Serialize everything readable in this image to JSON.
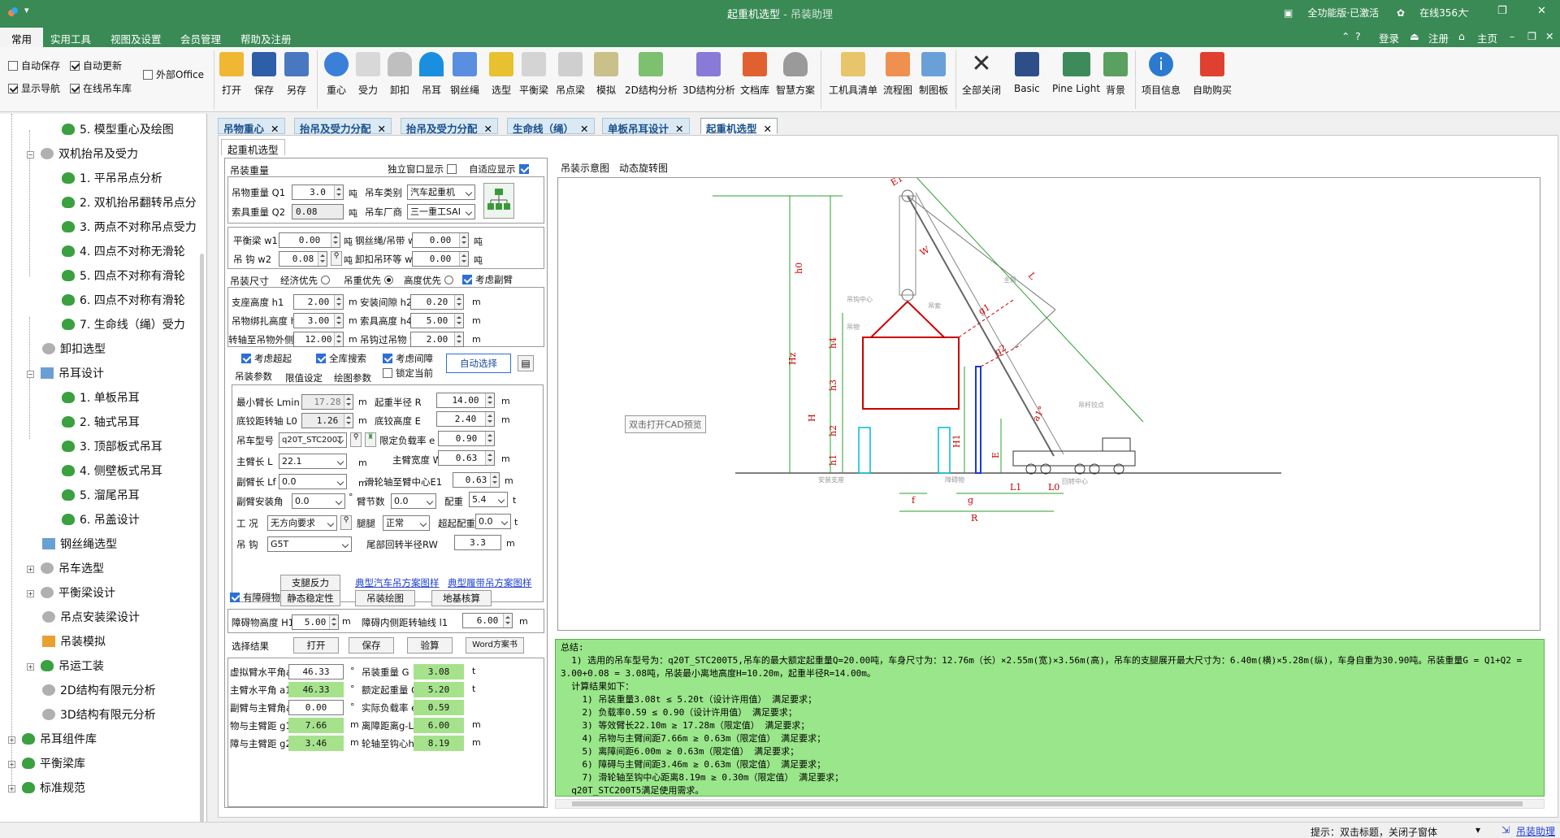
{
  "titlebar": {
    "title": "起重机选型",
    "subtitle": " - 吊装助理",
    "status_license": "全功能版·已激活",
    "status_online": "在线356人"
  },
  "menu": {
    "items": [
      "常用",
      "实用工具",
      "视图及设置",
      "会员管理",
      "帮助及注册"
    ],
    "right": [
      "登录",
      "注册",
      "主页"
    ]
  },
  "ribbon": {
    "checks": [
      {
        "label": "自动保存",
        "on": false
      },
      {
        "label": "自动更新",
        "on": true
      },
      {
        "label": "外部Office",
        "on": false
      },
      {
        "label": "显示导航",
        "on": true
      },
      {
        "label": "在线吊车库",
        "on": true
      }
    ],
    "buttons": [
      "打开",
      "保存",
      "另存",
      "重心",
      "受力",
      "卸扣",
      "吊耳",
      "钢丝绳",
      "选型",
      "平衡梁",
      "吊点梁",
      "模拟",
      "2D结构分析",
      "3D结构分析",
      "文档库",
      "智慧方案",
      "工机具清单",
      "流程图",
      "制图板",
      "全部关闭",
      "Basic",
      "Pine Light",
      "背景",
      "项目信息",
      "自助购买"
    ],
    "colors": {
      "accent": "#3a8a55",
      "summary_bg": "#9ae68a",
      "result_green": "#a6e28c"
    }
  },
  "tree": {
    "items": [
      "5. 模型重心及绘图",
      "双机抬吊及受力",
      "1. 平吊吊点分析",
      "2. 双机抬吊翻转吊点分",
      "3. 两点不对称吊点受力",
      "4. 四点不对称无滑轮",
      "5. 四点不对称有滑轮",
      "6. 四点不对称有滑轮",
      "7. 生命线（绳）受力",
      "卸扣选型",
      "吊耳设计",
      "1. 单板吊耳",
      "2. 轴式吊耳",
      "3. 顶部板式吊耳",
      "4. 侧壁板式吊耳",
      "5. 溜尾吊耳",
      "6. 吊盖设计",
      "钢丝绳选型",
      "吊车选型",
      "平衡梁设计",
      "吊点安装梁设计",
      "吊装模拟",
      "吊运工装",
      "2D结构有限元分析",
      "3D结构有限元分析",
      "吊耳组件库",
      "平衡梁库",
      "标准规范"
    ]
  },
  "doctabs": [
    "吊物重心",
    "抬吊及受力分配",
    "抬吊及受力分配",
    "生命线（绳）",
    "单板吊耳设计",
    "起重机选型"
  ],
  "inner_tab": "起重机选型",
  "form": {
    "sec1": {
      "title": "吊装重量",
      "opt1": "独立窗口显示",
      "opt2": "自适应显示",
      "q1_label": "吊物重量 Q1",
      "q1": "3.0",
      "q1_unit": "吨",
      "q2_label": "索具重量 Q2",
      "q2": "0.08",
      "q2_unit": "吨",
      "type_label": "吊车类别",
      "type": "汽车起重机",
      "maker_label": "吊车厂商",
      "maker": "三一重工SAI",
      "w1_label": "平衡梁 w1",
      "w1": "0.00",
      "w2_label": "吊 钩 w2",
      "w2": "0.08",
      "w3_label": "钢丝绳/吊带 w3",
      "w3": "0.00",
      "w4_label": "卸扣吊环等 w4",
      "w4": "0.00",
      "ton": "吨"
    },
    "sec2": {
      "title": "吊装尺寸",
      "r1": "经济优先",
      "r2": "吊重优先",
      "r3": "高度优先",
      "chk": "考虑副臂",
      "h1_label": "支座高度 h1",
      "h1": "2.00",
      "h3_label": "吊物绑扎高度 h3",
      "h3": "3.00",
      "g_label": "转轴至吊物外侧 g",
      "g": "12.00",
      "h2_label": "安装间隙 h2",
      "h2": "0.20",
      "h4_label": "索具高度 h4",
      "h4": "5.00",
      "f_label": "吊钩过吊物 f",
      "f": "2.00",
      "m": "m"
    },
    "sec3": {
      "c1": "考虑超起",
      "c2": "全库搜索",
      "c3": "考虑间障",
      "c4": "锁定当前",
      "auto_btn": "自动选择",
      "tabs": [
        "吊装参数",
        "限值设定",
        "绘图参数"
      ],
      "lmin_label": "最小臂长 Lmin",
      "lmin": "17.28",
      "l0_label": "底铰距转轴 L0",
      "l0": "1.26",
      "r_label": "起重半径 R",
      "r": "14.00",
      "e_label": "底铰高度 E",
      "e": "2.40",
      "model_label": "吊车型号",
      "model": "q20T_STC200T",
      "load_label": "限定负载率 e",
      "load": "0.90",
      "boom_label": "主臂长 L",
      "boom": "22.1",
      "width_label": "主臂宽度 W",
      "width": "0.63",
      "jib_label": "副臂长 Lf",
      "jib": "0.0",
      "e1_label": "滑轮轴至臂中心E1",
      "e1": "0.63",
      "jibangle_label": "副臂安装角",
      "jibangle": "0.0",
      "deg": "°",
      "sec_label": "臂节数",
      "sec": "0.0",
      "cw_label": "配重",
      "cw": "5.4",
      "mode_label": "工 况",
      "mode": "无方向要求",
      "leg_label": "腿腿",
      "leg": "正常",
      "scw_label": "超起配重",
      "scw": "0.0",
      "hook_label": "吊 钩",
      "hook": "G5T",
      "tail_label": "尾部回转半径RW",
      "tail": "3.3",
      "t": "t",
      "m": "m"
    },
    "sec4": {
      "b1": "支腿反力",
      "b2": "静态稳定性",
      "b3": "吊装绘图",
      "b4": "地基核算",
      "link1": "典型汽车吊方案图样",
      "link2": "典型履带吊方案图样",
      "chk": "有障碍物",
      "h1_label": "障碍物高度 H1",
      "h1": "5.00",
      "dist_label": "障碍内侧距转轴线 l1",
      "dist": "6.00",
      "m": "m"
    },
    "results": {
      "title": "选择结果",
      "b_open": "打开",
      "b_save": "保存",
      "b_check": "验算",
      "b_word": "Word方案书",
      "rows": [
        {
          "l": "虚拟臂水平角a",
          "v": "46.33",
          "u": "°",
          "l2": "吊装重量 G",
          "v2": "3.08",
          "u2": "t",
          "g1": false,
          "g2": true
        },
        {
          "l": "主臂水平角 a1",
          "v": "46.33",
          "u": "°",
          "l2": "额定起重量 Q",
          "v2": "5.20",
          "u2": "t",
          "g1": true,
          "g2": true
        },
        {
          "l": "副臂与主臂角a2",
          "v": "0.00",
          "u": "°",
          "l2": "实际负载率 e",
          "v2": "0.59",
          "u2": "",
          "g1": false,
          "g2": true
        },
        {
          "l": "物与主臂距 g1",
          "v": "7.66",
          "u": "m",
          "l2": "离障距离g-L1",
          "v2": "6.00",
          "u2": "m",
          "g1": true,
          "g2": true
        },
        {
          "l": "障与主臂距 g2",
          "v": "3.46",
          "u": "m",
          "l2": "轮轴至钩心h0",
          "v2": "8.19",
          "u2": "m",
          "g1": true,
          "g2": true
        }
      ]
    }
  },
  "diagram": {
    "tabs": [
      "吊装示意图",
      "动态旋转图"
    ],
    "tooltip": "双击打开CAD预览",
    "labels": {
      "E1": "E1",
      "h0": "h0",
      "W": "W",
      "L": "L",
      "center": "吊钩中心",
      "hook": "吊索",
      "obj": "吊物",
      "boom": "主臂",
      "g1": "g1",
      "g2": "g2",
      "h4": "h4",
      "h3": "h3",
      "h2": "h2",
      "h1": "h1",
      "Hz": "Hz",
      "H": "H",
      "H1": "H1",
      "E": "E",
      "a1": "a1°",
      "L1": "L1",
      "L0": "L0",
      "f": "f",
      "g": "g",
      "R": "R",
      "base": "安装支座",
      "obstacle": "障碍物",
      "center2": "回转中心",
      "hkline": "吊杆铰点"
    }
  },
  "summary": {
    "lines": [
      "总结:",
      "  1) 选用的吊车型号为：q20T_STC200T5,吊车的最大额定起重量Q=20.00吨，车身尺寸为：12.76m（长）×2.55m(宽)×3.56m(高)，吊车的支腿展开最大尺寸为：6.40m(横)×5.28m(纵)，车身自重为30.90吨。吊装重量G = Q1+Q2 =",
      "3.00+0.08 = 3.08吨，吊装最小离地高度H=10.20m，起重半径R=14.00m。",
      "  计算结果如下：",
      "    1) 吊装重量3.08t ≤ 5.20t（设计许用值） 满足要求；",
      "    2) 负载率0.59 ≤ 0.90（设计许用值） 满足要求；",
      "    3) 等效臂长22.10m ≥ 17.28m（限定值） 满足要求；",
      "    4) 吊物与主臂间距7.66m ≥ 0.63m（限定值） 满足要求；",
      "    5) 离障间距6.00m ≥ 0.63m（限定值） 满足要求；",
      "    6) 障碍与主臂间距3.46m ≥ 0.63m（限定值） 满足要求；",
      "    7) 滑轮轴至钩中心距离8.19m ≥ 0.30m（限定值） 满足要求；",
      "  q20T_STC200T5满足使用需求。"
    ]
  },
  "statusbar": {
    "hint": "提示：双击标题，关闭子窗体",
    "link": "吊装助理"
  }
}
